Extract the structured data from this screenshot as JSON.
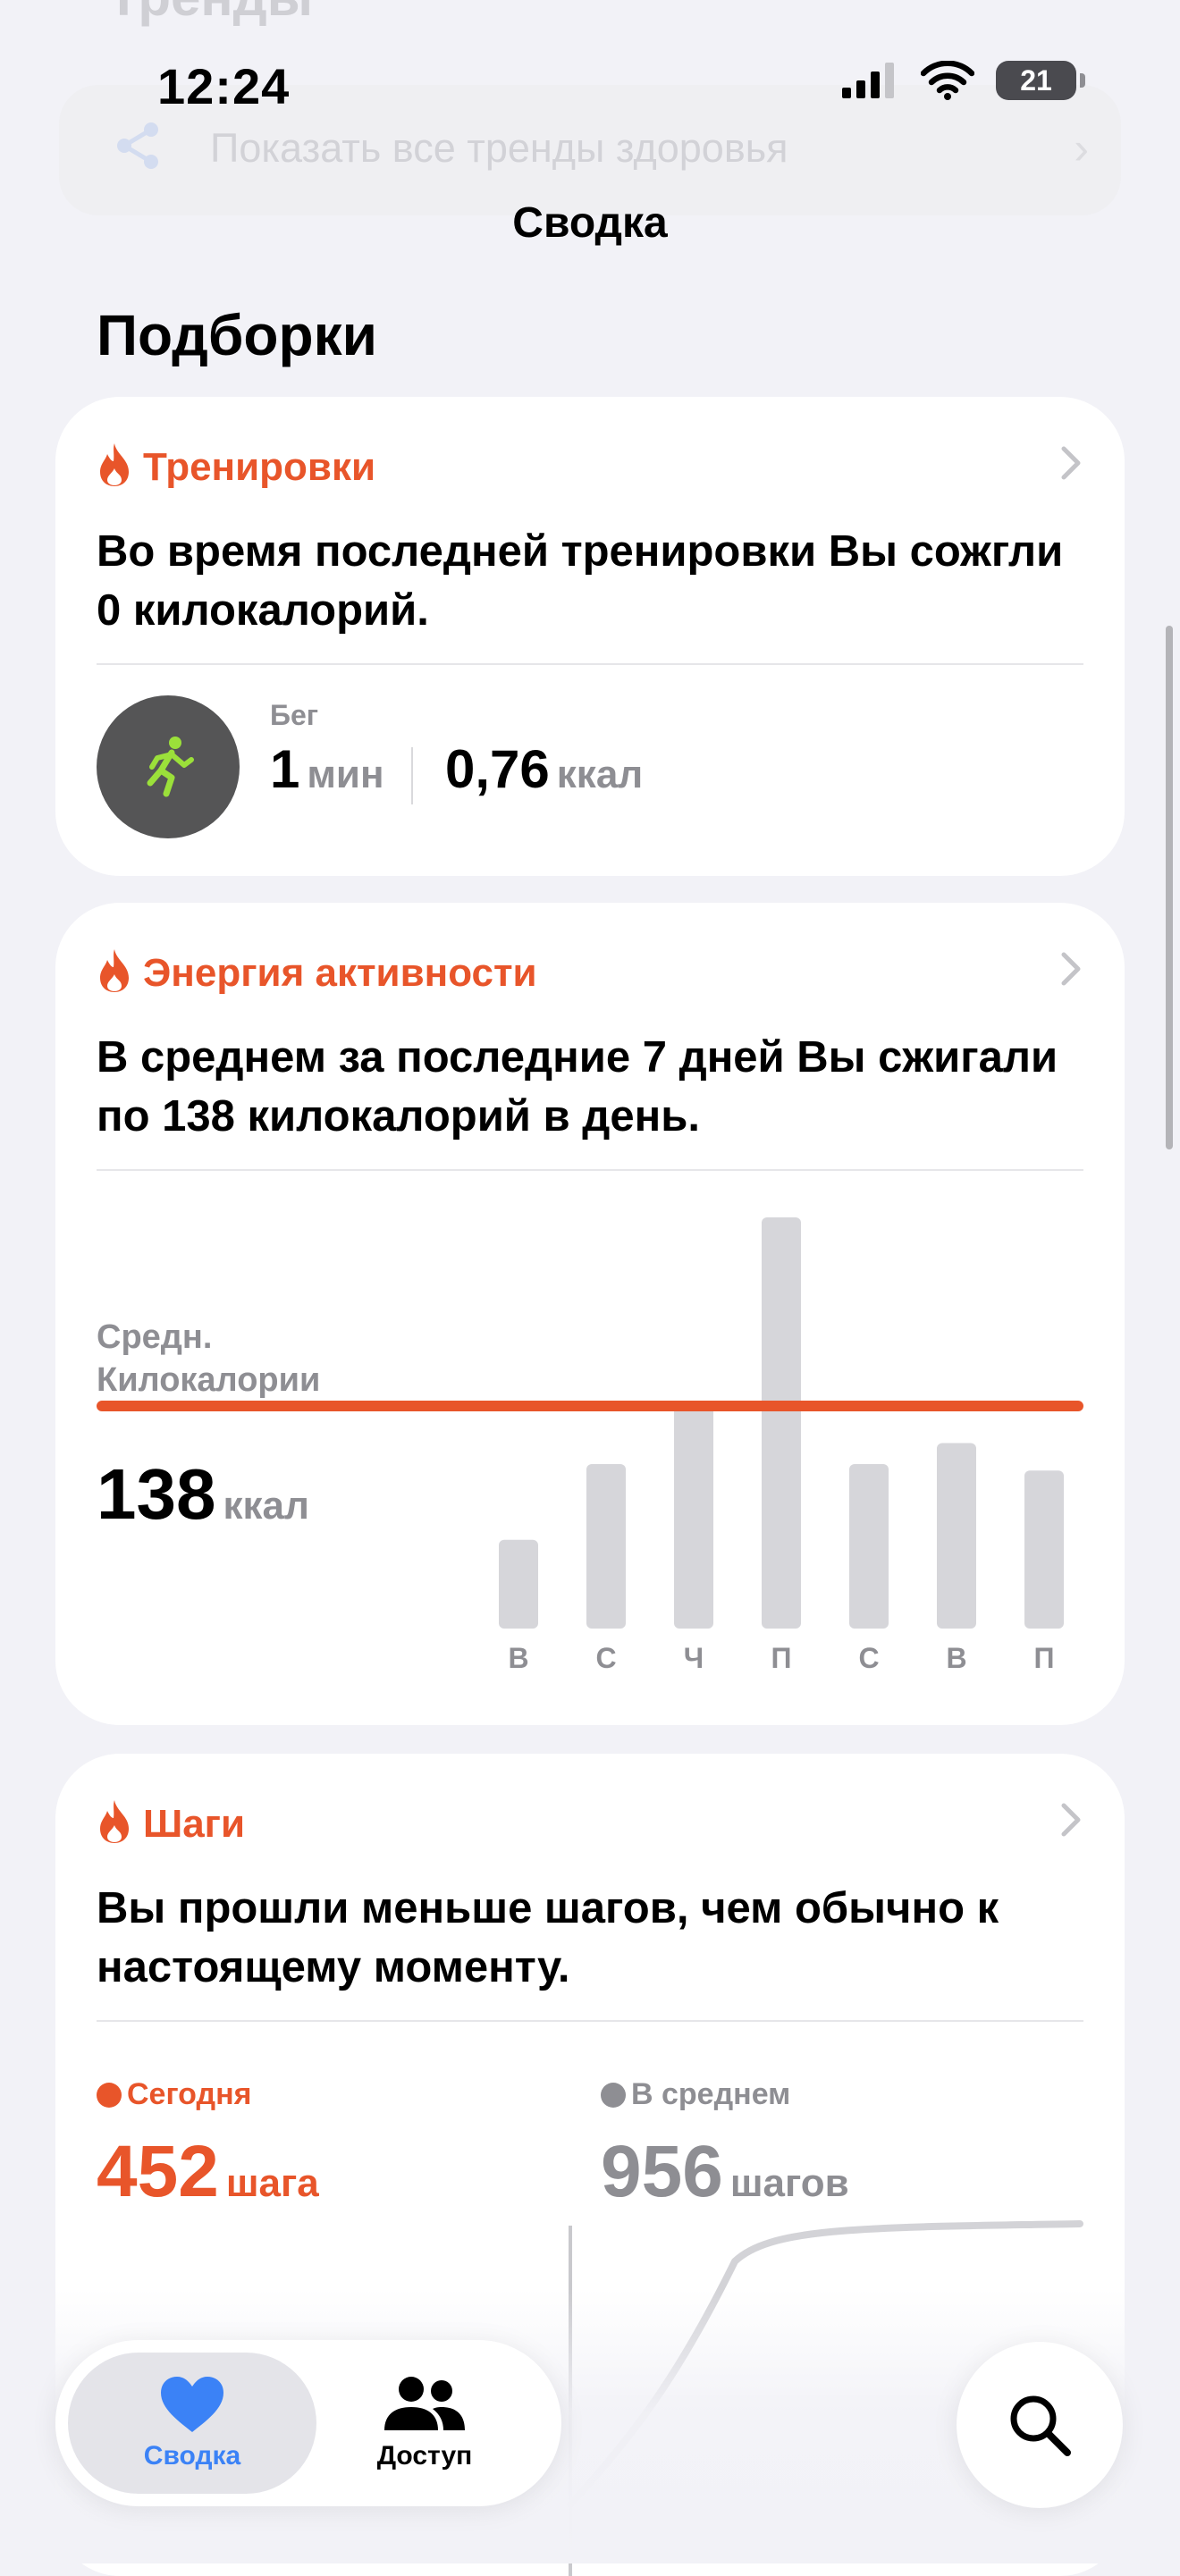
{
  "background_header": {
    "title": "Тренды",
    "link_text": "Показать все тренды здоровья"
  },
  "status_bar": {
    "time": "12:24",
    "battery": "21"
  },
  "nav": {
    "title": "Сводка"
  },
  "section": {
    "title": "Подборки"
  },
  "colors": {
    "accent": "#e8552a",
    "workout_icon": "#9be03a",
    "bar": "#d6d6da",
    "gray_text": "#8e8e93",
    "tab_active": "#3b82f6"
  },
  "workouts_card": {
    "title": "Тренировки",
    "body": "Во время последней тренировки Вы сожгли 0 килокалорий.",
    "icon": "running-figure-icon",
    "activity": "Бег",
    "duration_value": "1",
    "duration_unit": "мин",
    "energy_value": "0,76",
    "energy_unit": "ккал"
  },
  "energy_card": {
    "title": "Энергия активности",
    "body": "В среднем за последние 7 дней Вы сжигали по 138 килокалорий в день.",
    "avg_label_line1": "Средн.",
    "avg_label_line2": "Килокалории",
    "avg_value": "138",
    "avg_unit": "ккал"
  },
  "chart_data": {
    "type": "bar",
    "categories": [
      "В",
      "С",
      "Ч",
      "П",
      "С",
      "В",
      "П"
    ],
    "values": [
      55,
      102,
      138,
      255,
      102,
      115,
      98
    ],
    "average": 138,
    "ylim": [
      0,
      255
    ],
    "title": "",
    "xlabel": "",
    "ylabel": "",
    "grid": false
  },
  "steps_card": {
    "title": "Шаги",
    "body": "Вы прошли меньше шагов, чем обычно к настоящему моменту.",
    "today_label": "Сегодня",
    "today_value": "452",
    "today_unit": "шага",
    "avg_label": "В среднем",
    "avg_value": "956",
    "avg_unit": "шагов"
  },
  "tabbar": {
    "summary_label": "Сводка",
    "sharing_label": "Доступ"
  }
}
